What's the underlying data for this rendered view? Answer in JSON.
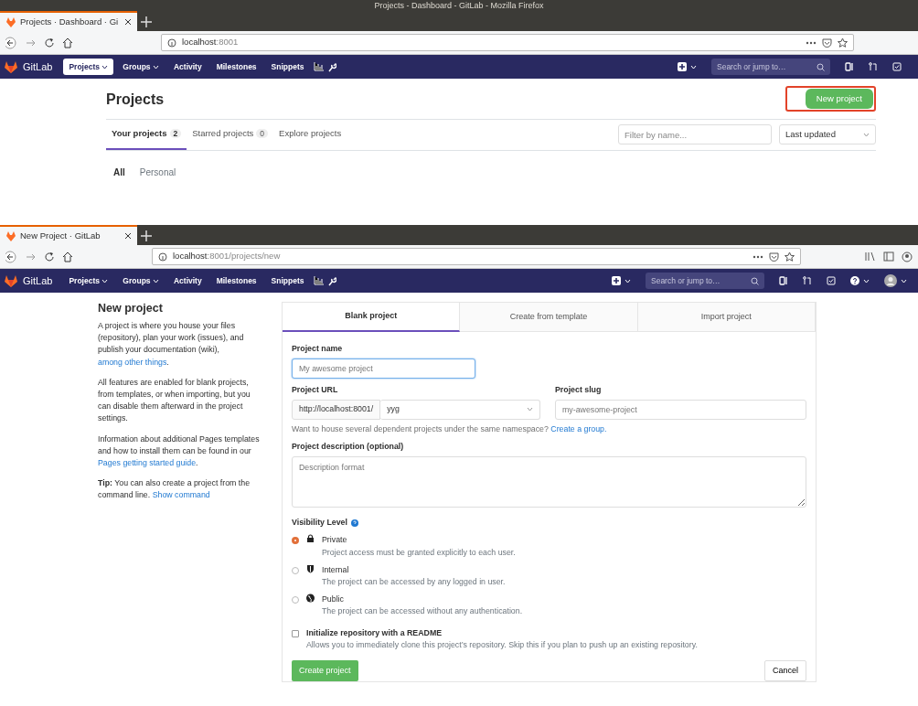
{
  "window_title": "Projects - Dashboard - GitLab - Mozilla Firefox",
  "windows": [
    {
      "kind": "dashboard",
      "tab": "Projects · Dashboard · Gi",
      "url_host": "localhost",
      "url_path": ":8001",
      "extra_toolbar": false,
      "nav": {
        "brand": "GitLab",
        "help_menu": false,
        "search_placeholder": "Search or jump to…",
        "items": [
          {
            "label": "Projects",
            "dropdown": true,
            "selected": true
          },
          {
            "label": "Groups",
            "dropdown": true,
            "selected": false
          },
          {
            "label": "Activity",
            "dropdown": false,
            "selected": false
          },
          {
            "label": "Milestones",
            "dropdown": false,
            "selected": false
          },
          {
            "label": "Snippets",
            "dropdown": false,
            "selected": false
          }
        ]
      },
      "page": {
        "title": "Projects",
        "new_button": {
          "label": "New project",
          "highlighted": true
        },
        "tabs": [
          {
            "label": "Your projects",
            "count": "2",
            "selected": true
          },
          {
            "label": "Starred projects",
            "count": "0",
            "selected": false
          },
          {
            "label": "Explore projects",
            "selected": false
          }
        ],
        "filter_placeholder": "Filter by name...",
        "sort": "Last updated",
        "subtabs": [
          {
            "label": "All",
            "selected": true
          },
          {
            "label": "Personal",
            "selected": false
          }
        ]
      }
    },
    {
      "kind": "new_project",
      "tab": "New Project · GitLab",
      "url_host": "localhost",
      "url_path": ":8001/projects/new",
      "extra_toolbar": true,
      "nav": {
        "brand": "GitLab",
        "help_menu": true,
        "search_placeholder": "Search or jump to…",
        "items": [
          {
            "label": "Projects",
            "dropdown": true,
            "selected": false
          },
          {
            "label": "Groups",
            "dropdown": true,
            "selected": false
          },
          {
            "label": "Activity",
            "dropdown": false,
            "selected": false
          },
          {
            "label": "Milestones",
            "dropdown": false,
            "selected": false
          },
          {
            "label": "Snippets",
            "dropdown": false,
            "selected": false
          }
        ]
      },
      "page": {
        "heading": "New project",
        "paragraphs": [
          [
            {
              "text": "A project is where you house your files (repository), plan your work (issues), and publish your documentation (wiki), "
            },
            {
              "link": "among other things"
            },
            {
              "text": "."
            }
          ],
          [
            {
              "text": "All features are enabled for blank projects, from templates, or when importing, but you can disable them afterward in the project settings."
            }
          ],
          [
            {
              "text": "Information about additional Pages templates and how to install them can be found in our "
            },
            {
              "link": "Pages getting started guide"
            },
            {
              "text": "."
            }
          ],
          [
            {
              "text": "**Tip:** You can also create a project from the command line. "
            },
            {
              "link": "Show command"
            }
          ]
        ],
        "tabs": [
          {
            "label": "Blank project",
            "selected": true
          },
          {
            "label": "Create from template",
            "selected": false
          },
          {
            "label": "Import project",
            "selected": false
          }
        ],
        "project_name": {
          "label": "Project name",
          "placeholder": "My awesome project"
        },
        "project_url": {
          "label": "Project URL",
          "prefix": "http://localhost:8001/",
          "namespace": "yyg"
        },
        "project_slug": {
          "label": "Project slug",
          "placeholder": "my-awesome-project"
        },
        "namespace_help": {
          "text": "Want to house several dependent projects under the same namespace? ",
          "link": "Create a group."
        },
        "description": {
          "label": "Project description (optional)",
          "placeholder": "Description format"
        },
        "visibility_label": "Visibility Level",
        "visibility": [
          {
            "kind": "lock",
            "label": "Private",
            "description": "Project access must be granted explicitly to each user.",
            "selected": true
          },
          {
            "kind": "shield",
            "label": "Internal",
            "description": "The project can be accessed by any logged in user.",
            "selected": false
          },
          {
            "kind": "globe",
            "label": "Public",
            "description": "The project can be accessed without any authentication.",
            "selected": false
          }
        ],
        "readme": {
          "label": "Initialize repository with a README",
          "description": "Allows you to immediately clone this project’s repository. Skip this if you plan to push up an existing repository.",
          "checked": false
        },
        "create_button": "Create project",
        "cancel_button": "Cancel"
      }
    }
  ]
}
